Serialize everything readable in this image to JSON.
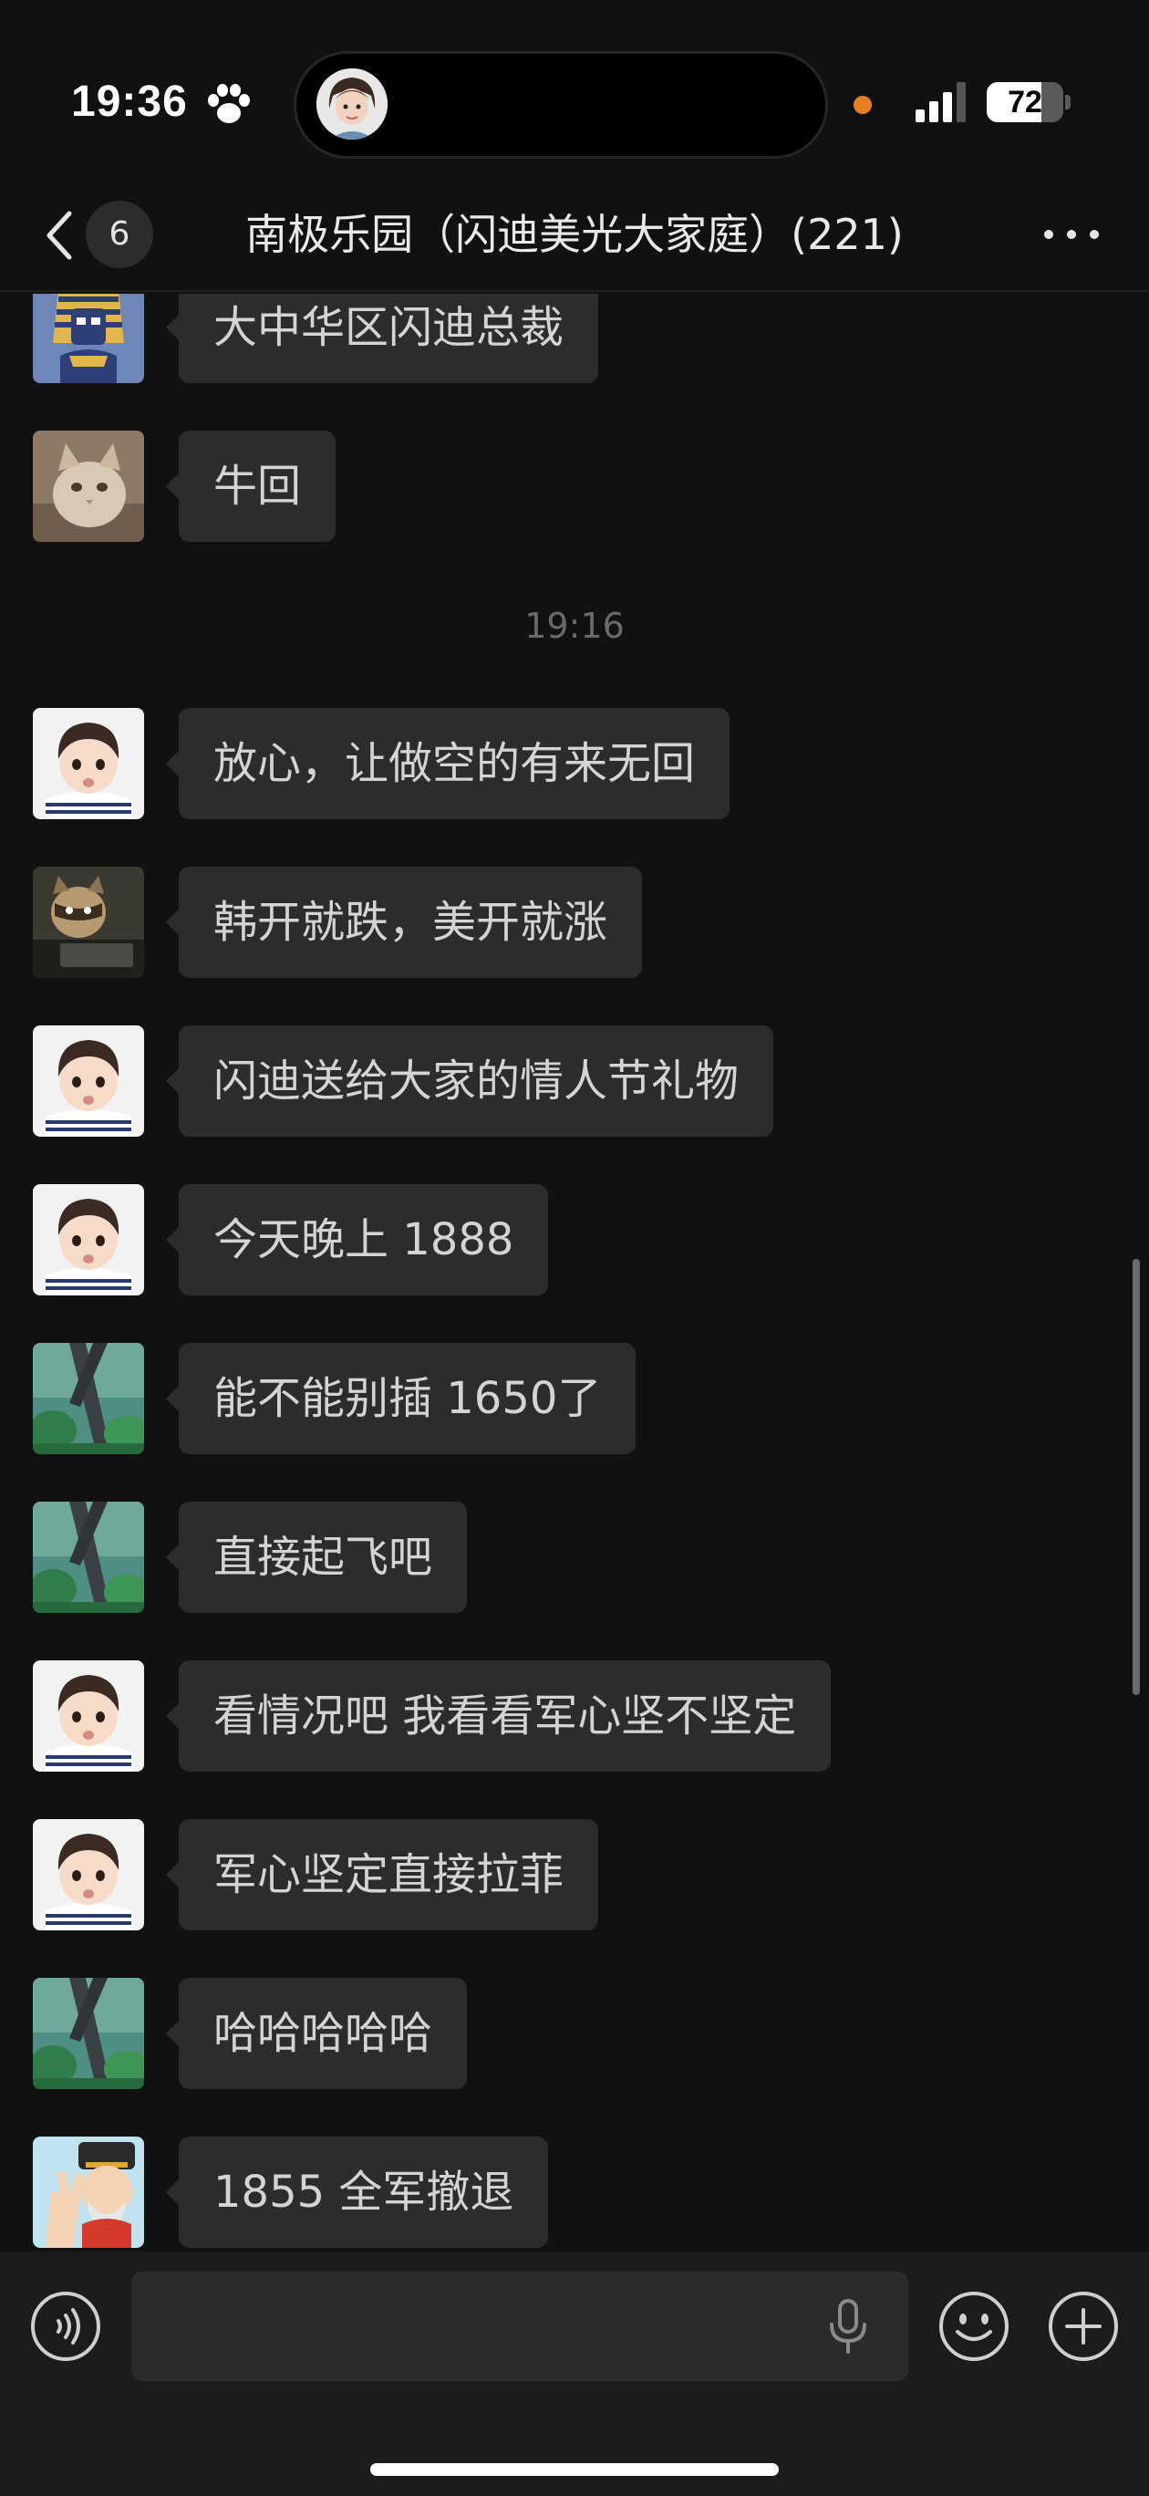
{
  "status_bar": {
    "time": "19:36",
    "battery_percent": "72",
    "battery_level": 0.72,
    "paw_icon": "paw-icon",
    "signal_icon": "cellular-signal-icon"
  },
  "nav": {
    "back_icon": "chevron-left-icon",
    "unread_count": "6",
    "title": "南极乐园（闪迪美光大家庭）(221)",
    "more_icon": "more-dots-icon"
  },
  "messages": [
    {
      "text": "大中华区闪迪总裁",
      "avatar": "pharaoh-avatar"
    },
    {
      "text": "牛回",
      "avatar": "cat-avatar"
    },
    {
      "text": "放心，让做空的有来无回",
      "avatar": "boy-avatar"
    },
    {
      "text": "韩开就跌，美开就涨",
      "avatar": "raccoon-avatar"
    },
    {
      "text": "闪迪送给大家的情人节礼物",
      "avatar": "boy-avatar"
    },
    {
      "text": "今天晚上 1888",
      "avatar": "boy-avatar"
    },
    {
      "text": "能不能别插 1650了",
      "avatar": "forest-avatar"
    },
    {
      "text": "直接起飞吧",
      "avatar": "forest-avatar"
    },
    {
      "text": "看情况吧 我看看军心坚不坚定",
      "avatar": "boy-avatar"
    },
    {
      "text": "军心坚定直接拉菲",
      "avatar": "boy-avatar"
    },
    {
      "text": "哈哈哈哈哈",
      "avatar": "forest-avatar"
    },
    {
      "text": "1855 全军撤退",
      "avatar": "fortune-god-avatar"
    }
  ],
  "timestamp": "19:16",
  "input_bar": {
    "placeholder": "",
    "voice_icon": "voice-icon",
    "mic_icon": "microphone-icon",
    "emoji_icon": "emoji-icon",
    "add_icon": "plus-icon"
  },
  "colors": {
    "background": "#111111",
    "bubble": "#2c2c2c",
    "text": "#d4d4d4",
    "input_bar": "#1c1c1c"
  }
}
